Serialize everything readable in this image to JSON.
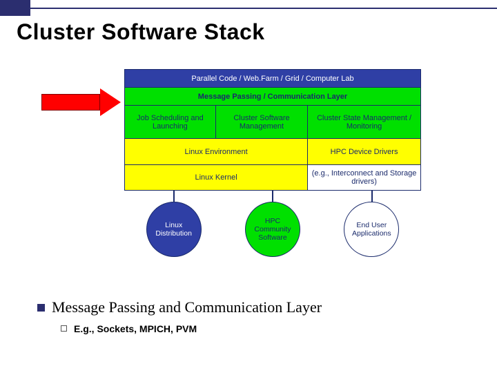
{
  "title": "Cluster Software Stack",
  "stack": {
    "row_top": "Parallel Code / Web.Farm / Grid / Computer Lab",
    "row_msg": "Message Passing / Communication Layer",
    "row_mid": {
      "a": "Job Scheduling and Launching",
      "b": "Cluster Software Management",
      "c": "Cluster State Management / Monitoring"
    },
    "row_linux_env": "Linux Environment",
    "row_hpc_drivers": "HPC Device Drivers",
    "row_kernel": "Linux Kernel",
    "row_interconnect": "(e.g., Interconnect and Storage drivers)"
  },
  "circles": {
    "c1": "Linux Distribution",
    "c2": "HPC Community Software",
    "c3": "End User Applications"
  },
  "bullet": {
    "main": "Message Passing and Communication Layer",
    "sub": "E.g., Sockets, MPICH, PVM"
  }
}
